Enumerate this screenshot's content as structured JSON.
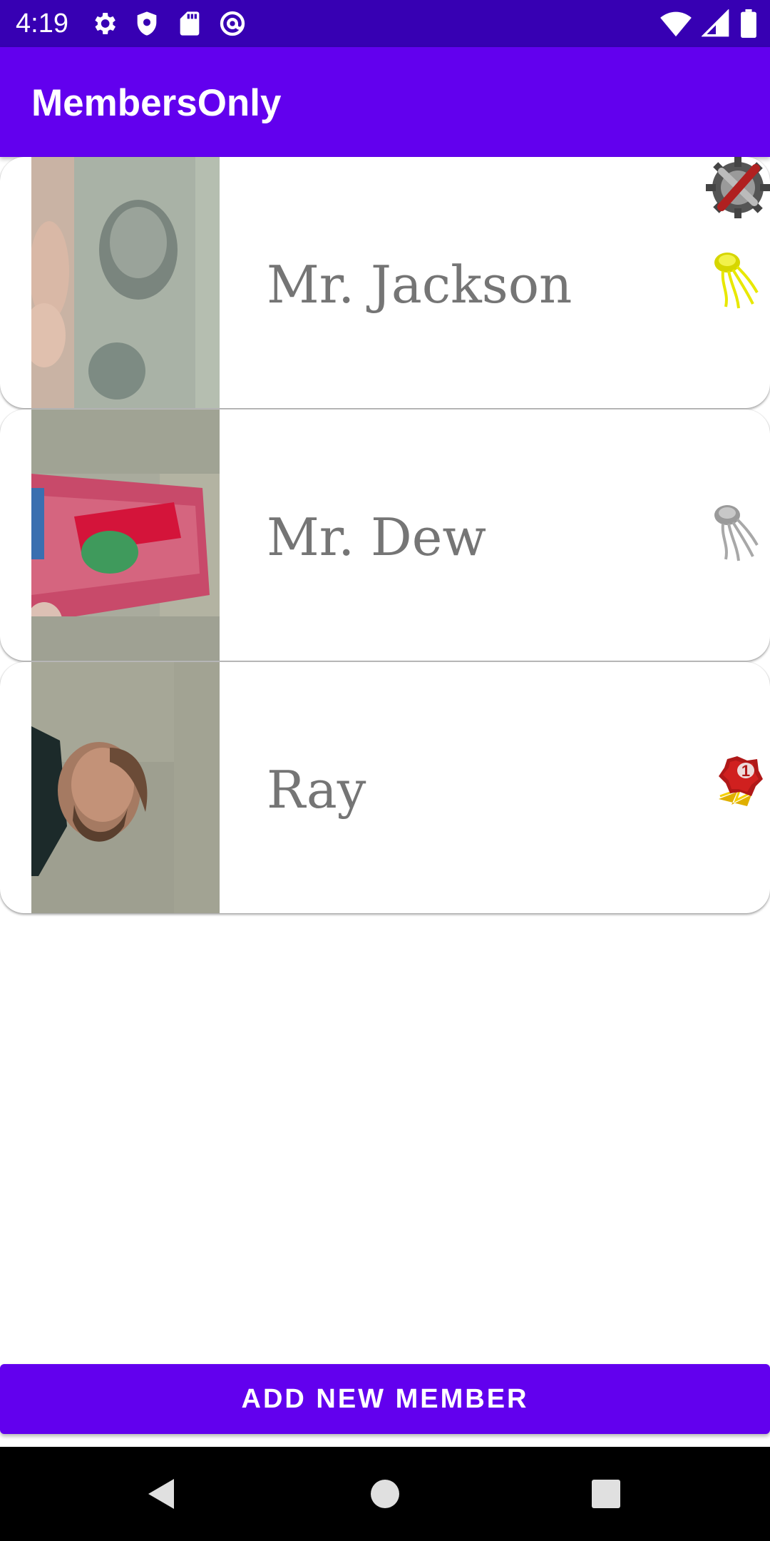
{
  "status_bar": {
    "time": "4:19",
    "left_icons": [
      "gear-icon",
      "shield-icon",
      "sd-card-icon",
      "at-sign-icon"
    ],
    "right_icons": [
      "wifi-icon",
      "signal-icon",
      "battery-icon"
    ]
  },
  "app_bar": {
    "title": "MembersOnly"
  },
  "members": [
    {
      "name": "Mr. Jackson",
      "photo": "twenty-dollar-bill-photo",
      "badges": [
        "admin-tools-badge-icon",
        "gold-medal-badge-icon"
      ]
    },
    {
      "name": "Mr. Dew",
      "photo": "soda-can-photo",
      "badges": [
        "silver-medal-badge-icon"
      ]
    },
    {
      "name": "Ray",
      "photo": "man-portrait-photo",
      "badges": [
        "first-place-ribbon-badge-icon"
      ]
    }
  ],
  "actions": {
    "add_member_label": "ADD NEW MEMBER"
  },
  "nav_bar": {
    "buttons": [
      "back-icon",
      "home-icon",
      "recents-icon"
    ]
  },
  "colors": {
    "status_bar": "#3700b3",
    "primary": "#6200ee",
    "name_text": "#757575"
  }
}
